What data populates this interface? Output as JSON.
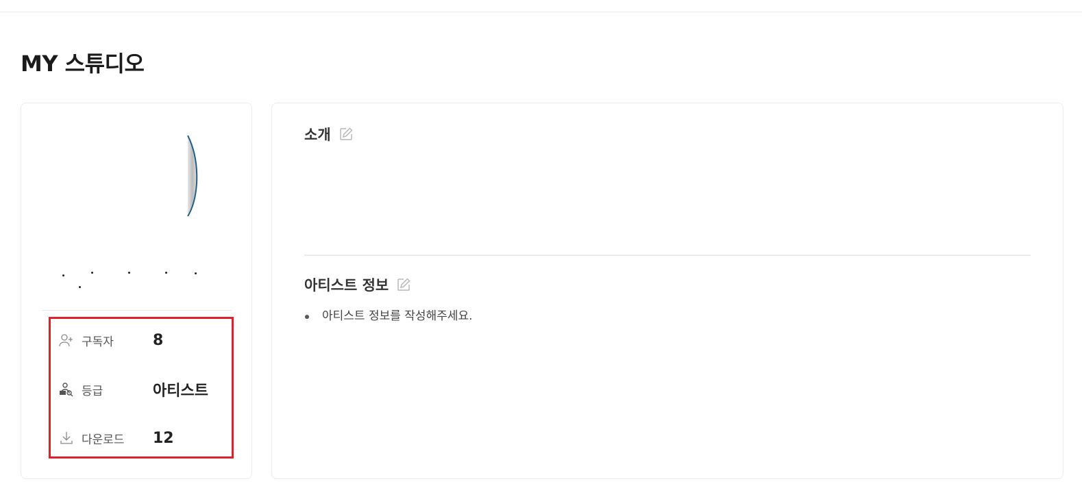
{
  "page": {
    "title": "MY 스튜디오"
  },
  "profile": {
    "stats": [
      {
        "icon": "user-plus-icon",
        "label": "구독자",
        "value": "8"
      },
      {
        "icon": "grade-icon",
        "label": "등급",
        "value": "아티스트"
      },
      {
        "icon": "download-icon",
        "label": "다운로드",
        "value": "12"
      }
    ]
  },
  "sections": {
    "intro": {
      "title": "소개"
    },
    "artist_info": {
      "title": "아티스트 정보",
      "items": [
        "아티스트 정보를 작성해주세요."
      ]
    }
  },
  "colors": {
    "highlight": "#e0202a",
    "avatar_ring": "#1f5f8b"
  }
}
